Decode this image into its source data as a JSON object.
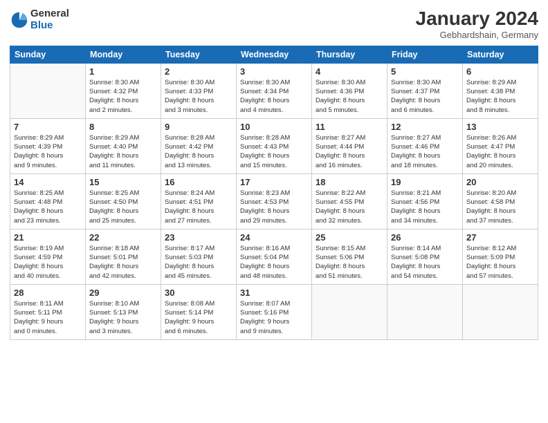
{
  "header": {
    "logo_general": "General",
    "logo_blue": "Blue",
    "month_title": "January 2024",
    "location": "Gebhardshain, Germany"
  },
  "days_of_week": [
    "Sunday",
    "Monday",
    "Tuesday",
    "Wednesday",
    "Thursday",
    "Friday",
    "Saturday"
  ],
  "weeks": [
    [
      {
        "day": "",
        "info": ""
      },
      {
        "day": "1",
        "info": "Sunrise: 8:30 AM\nSunset: 4:32 PM\nDaylight: 8 hours\nand 2 minutes."
      },
      {
        "day": "2",
        "info": "Sunrise: 8:30 AM\nSunset: 4:33 PM\nDaylight: 8 hours\nand 3 minutes."
      },
      {
        "day": "3",
        "info": "Sunrise: 8:30 AM\nSunset: 4:34 PM\nDaylight: 8 hours\nand 4 minutes."
      },
      {
        "day": "4",
        "info": "Sunrise: 8:30 AM\nSunset: 4:36 PM\nDaylight: 8 hours\nand 5 minutes."
      },
      {
        "day": "5",
        "info": "Sunrise: 8:30 AM\nSunset: 4:37 PM\nDaylight: 8 hours\nand 6 minutes."
      },
      {
        "day": "6",
        "info": "Sunrise: 8:29 AM\nSunset: 4:38 PM\nDaylight: 8 hours\nand 8 minutes."
      }
    ],
    [
      {
        "day": "7",
        "info": "Sunrise: 8:29 AM\nSunset: 4:39 PM\nDaylight: 8 hours\nand 9 minutes."
      },
      {
        "day": "8",
        "info": "Sunrise: 8:29 AM\nSunset: 4:40 PM\nDaylight: 8 hours\nand 11 minutes."
      },
      {
        "day": "9",
        "info": "Sunrise: 8:28 AM\nSunset: 4:42 PM\nDaylight: 8 hours\nand 13 minutes."
      },
      {
        "day": "10",
        "info": "Sunrise: 8:28 AM\nSunset: 4:43 PM\nDaylight: 8 hours\nand 15 minutes."
      },
      {
        "day": "11",
        "info": "Sunrise: 8:27 AM\nSunset: 4:44 PM\nDaylight: 8 hours\nand 16 minutes."
      },
      {
        "day": "12",
        "info": "Sunrise: 8:27 AM\nSunset: 4:46 PM\nDaylight: 8 hours\nand 18 minutes."
      },
      {
        "day": "13",
        "info": "Sunrise: 8:26 AM\nSunset: 4:47 PM\nDaylight: 8 hours\nand 20 minutes."
      }
    ],
    [
      {
        "day": "14",
        "info": "Sunrise: 8:25 AM\nSunset: 4:48 PM\nDaylight: 8 hours\nand 23 minutes."
      },
      {
        "day": "15",
        "info": "Sunrise: 8:25 AM\nSunset: 4:50 PM\nDaylight: 8 hours\nand 25 minutes."
      },
      {
        "day": "16",
        "info": "Sunrise: 8:24 AM\nSunset: 4:51 PM\nDaylight: 8 hours\nand 27 minutes."
      },
      {
        "day": "17",
        "info": "Sunrise: 8:23 AM\nSunset: 4:53 PM\nDaylight: 8 hours\nand 29 minutes."
      },
      {
        "day": "18",
        "info": "Sunrise: 8:22 AM\nSunset: 4:55 PM\nDaylight: 8 hours\nand 32 minutes."
      },
      {
        "day": "19",
        "info": "Sunrise: 8:21 AM\nSunset: 4:56 PM\nDaylight: 8 hours\nand 34 minutes."
      },
      {
        "day": "20",
        "info": "Sunrise: 8:20 AM\nSunset: 4:58 PM\nDaylight: 8 hours\nand 37 minutes."
      }
    ],
    [
      {
        "day": "21",
        "info": "Sunrise: 8:19 AM\nSunset: 4:59 PM\nDaylight: 8 hours\nand 40 minutes."
      },
      {
        "day": "22",
        "info": "Sunrise: 8:18 AM\nSunset: 5:01 PM\nDaylight: 8 hours\nand 42 minutes."
      },
      {
        "day": "23",
        "info": "Sunrise: 8:17 AM\nSunset: 5:03 PM\nDaylight: 8 hours\nand 45 minutes."
      },
      {
        "day": "24",
        "info": "Sunrise: 8:16 AM\nSunset: 5:04 PM\nDaylight: 8 hours\nand 48 minutes."
      },
      {
        "day": "25",
        "info": "Sunrise: 8:15 AM\nSunset: 5:06 PM\nDaylight: 8 hours\nand 51 minutes."
      },
      {
        "day": "26",
        "info": "Sunrise: 8:14 AM\nSunset: 5:08 PM\nDaylight: 8 hours\nand 54 minutes."
      },
      {
        "day": "27",
        "info": "Sunrise: 8:12 AM\nSunset: 5:09 PM\nDaylight: 8 hours\nand 57 minutes."
      }
    ],
    [
      {
        "day": "28",
        "info": "Sunrise: 8:11 AM\nSunset: 5:11 PM\nDaylight: 9 hours\nand 0 minutes."
      },
      {
        "day": "29",
        "info": "Sunrise: 8:10 AM\nSunset: 5:13 PM\nDaylight: 9 hours\nand 3 minutes."
      },
      {
        "day": "30",
        "info": "Sunrise: 8:08 AM\nSunset: 5:14 PM\nDaylight: 9 hours\nand 6 minutes."
      },
      {
        "day": "31",
        "info": "Sunrise: 8:07 AM\nSunset: 5:16 PM\nDaylight: 9 hours\nand 9 minutes."
      },
      {
        "day": "",
        "info": ""
      },
      {
        "day": "",
        "info": ""
      },
      {
        "day": "",
        "info": ""
      }
    ]
  ]
}
